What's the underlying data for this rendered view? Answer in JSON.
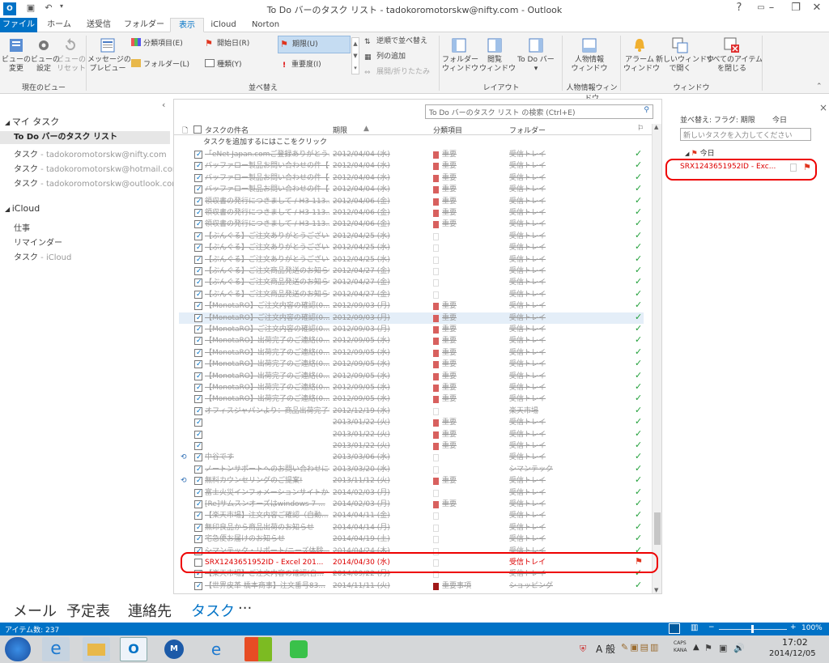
{
  "window": {
    "title": "To Do バーのタスク リスト - tadokoromotorskw@nifty.com - Outlook"
  },
  "tabs": [
    "ファイル",
    "ホーム",
    "送受信",
    "フォルダー",
    "表示",
    "iCloud",
    "Norton"
  ],
  "ribbon": {
    "view_change": "ビューの\n変更",
    "view_settings": "ビューの\n設定",
    "view_reset": "ビューの\nリセット",
    "message_preview": "メッセージの\nプレビュー",
    "category": "分類項目(E)",
    "start_date": "開始日(R)",
    "due_date": "期限(U)",
    "folder": "フォルダー(L)",
    "type": "種類(Y)",
    "importance": "重要度(I)",
    "reverse_sort": "逆順で並べ替え",
    "add_columns": "列の追加",
    "expand_collapse": "展開/折りたたみ",
    "folder_pane": "フォルダー\nウィンドウ",
    "reading_pane": "閲覧\nウィンドウ",
    "todo_bar": "To Do バー",
    "people_pane": "人物情報\nウィンドウ",
    "reminders": "アラーム\nウィンドウ",
    "open_new_window": "新しいウィンドウ\nで開く",
    "close_all": "すべてのアイテム\nを閉じる",
    "groups": {
      "current_view": "現在のビュー",
      "arrangement": "並べ替え",
      "layout": "レイアウト",
      "people": "人物情報ウィンドウ",
      "window": "ウィンドウ"
    }
  },
  "sidebar": {
    "my_tasks": "マイ タスク",
    "items": [
      {
        "label": "To Do バーのタスク リスト",
        "suffix": ""
      },
      {
        "label": "タスク",
        "suffix": " - tadokoromotorskw@nifty.com"
      },
      {
        "label": "タスク",
        "suffix": " - tadokoromotorskw@hotmail.com"
      },
      {
        "label": "タスク",
        "suffix": " - tadokoromotorskw@outlook.com"
      }
    ],
    "icloud": "iCloud",
    "icloud_items": [
      {
        "label": "仕事",
        "suffix": ""
      },
      {
        "label": "リマインダー",
        "suffix": ""
      },
      {
        "label": "タスク",
        "suffix": " - iCloud"
      }
    ]
  },
  "tasklist": {
    "search_placeholder": "To Do バーのタスク リスト の検索 (Ctrl+E)",
    "columns": {
      "subject": "タスクの件名",
      "due": "期限",
      "category": "分類項目",
      "folder": "フォルダー"
    },
    "add_task": "タスクを追加するにはここをクリック",
    "rows": [
      {
        "subject": "「eNet Japan.comご登録ありがとう...",
        "due": "2012/04/04 (水)",
        "cat": "red",
        "catname": "重要",
        "folder": "受信トレイ",
        "icon": ""
      },
      {
        "subject": "バッファロー製品お問い合わせの件【お...",
        "due": "2012/04/04 (水)",
        "cat": "red",
        "catname": "重要",
        "folder": "受信トレイ",
        "icon": ""
      },
      {
        "subject": "バッファロー製品お問い合わせの件【お...",
        "due": "2012/04/04 (水)",
        "cat": "red",
        "catname": "重要",
        "folder": "受信トレイ",
        "icon": ""
      },
      {
        "subject": "バッファロー製品お問い合わせの件【お...",
        "due": "2012/04/04 (水)",
        "cat": "red",
        "catname": "重要",
        "folder": "受信トレイ",
        "icon": ""
      },
      {
        "subject": "領収書の発行につきまして / H3-113...",
        "due": "2012/04/06 (金)",
        "cat": "red",
        "catname": "重要",
        "folder": "受信トレイ",
        "icon": ""
      },
      {
        "subject": "領収書の発行につきまして / H3-113...",
        "due": "2012/04/06 (金)",
        "cat": "red",
        "catname": "重要",
        "folder": "受信トレイ",
        "icon": ""
      },
      {
        "subject": "領収書の発行につきまして / H3-113...",
        "due": "2012/04/06 (金)",
        "cat": "red",
        "catname": "重要",
        "folder": "受信トレイ",
        "icon": ""
      },
      {
        "subject": "【ぶんぐる】ご注文ありがとうございます。",
        "due": "2012/04/25 (水)",
        "cat": "",
        "catname": "",
        "folder": "受信トレイ",
        "icon": ""
      },
      {
        "subject": "【ぶんぐる】ご注文ありがとうございます。",
        "due": "2012/04/25 (水)",
        "cat": "",
        "catname": "",
        "folder": "受信トレイ",
        "icon": ""
      },
      {
        "subject": "【ぶんぐる】ご注文ありがとうございます。",
        "due": "2012/04/25 (水)",
        "cat": "",
        "catname": "",
        "folder": "受信トレイ",
        "icon": ""
      },
      {
        "subject": "【ぶんぐる】ご注文商品発送のお知らせ",
        "due": "2012/04/27 (金)",
        "cat": "",
        "catname": "",
        "folder": "受信トレイ",
        "icon": ""
      },
      {
        "subject": "【ぶんぐる】ご注文商品発送のお知らせ",
        "due": "2012/04/27 (金)",
        "cat": "",
        "catname": "",
        "folder": "受信トレイ",
        "icon": ""
      },
      {
        "subject": "【ぶんぐる】ご注文商品発送のお知らせ",
        "due": "2012/04/27 (金)",
        "cat": "",
        "catname": "",
        "folder": "受信トレイ",
        "icon": ""
      },
      {
        "subject": "【MonotaRO】ご注文内容の確認(0...",
        "due": "2012/09/03 (月)",
        "cat": "red",
        "catname": "重要",
        "folder": "受信トレイ",
        "icon": ""
      },
      {
        "subject": "【MonotaRO】ご注文内容の確認(0...",
        "due": "2012/09/03 (月)",
        "cat": "red",
        "catname": "重要",
        "folder": "受信トレイ",
        "icon": "",
        "hl": true
      },
      {
        "subject": "【MonotaRO】ご注文内容の確認(0...",
        "due": "2012/09/03 (月)",
        "cat": "red",
        "catname": "重要",
        "folder": "受信トレイ",
        "icon": ""
      },
      {
        "subject": "【MonotaRO】出荷完了のご連絡(0...",
        "due": "2012/09/05 (水)",
        "cat": "red",
        "catname": "重要",
        "folder": "受信トレイ",
        "icon": ""
      },
      {
        "subject": "【MonotaRO】出荷完了のご連絡(0...",
        "due": "2012/09/05 (水)",
        "cat": "red",
        "catname": "重要",
        "folder": "受信トレイ",
        "icon": ""
      },
      {
        "subject": "【MonotaRO】出荷完了のご連絡(0...",
        "due": "2012/09/05 (水)",
        "cat": "red",
        "catname": "重要",
        "folder": "受信トレイ",
        "icon": ""
      },
      {
        "subject": "【MonotaRO】出荷完了のご連絡(0...",
        "due": "2012/09/05 (水)",
        "cat": "red",
        "catname": "重要",
        "folder": "受信トレイ",
        "icon": ""
      },
      {
        "subject": "【MonotaRO】出荷完了のご連絡(0...",
        "due": "2012/09/05 (水)",
        "cat": "red",
        "catname": "重要",
        "folder": "受信トレイ",
        "icon": ""
      },
      {
        "subject": "【MonotaRO】出荷完了のご連絡(0...",
        "due": "2012/09/05 (水)",
        "cat": "red",
        "catname": "重要",
        "folder": "受信トレイ",
        "icon": ""
      },
      {
        "subject": "オフィスジャパンより：商品出荷完了い...",
        "due": "2012/12/19 (水)",
        "cat": "",
        "catname": "",
        "folder": "楽天市場",
        "icon": ""
      },
      {
        "subject": "",
        "due": "2013/01/22 (火)",
        "cat": "red",
        "catname": "重要",
        "folder": "受信トレイ",
        "icon": ""
      },
      {
        "subject": "",
        "due": "2013/01/22 (火)",
        "cat": "red",
        "catname": "重要",
        "folder": "受信トレイ",
        "icon": ""
      },
      {
        "subject": "",
        "due": "2013/01/22 (火)",
        "cat": "red",
        "catname": "重要",
        "folder": "受信トレイ",
        "icon": ""
      },
      {
        "subject": "中谷です",
        "due": "2013/03/06 (水)",
        "cat": "",
        "catname": "",
        "folder": "受信トレイ",
        "icon": "⟲"
      },
      {
        "subject": "ノートンサポートへのお問い合わせにつ...",
        "due": "2013/03/20 (水)",
        "cat": "",
        "catname": "",
        "folder": "シマンテック",
        "icon": ""
      },
      {
        "subject": "無料カウンセリングのご提案!",
        "due": "2013/11/12 (火)",
        "cat": "red",
        "catname": "重要",
        "folder": "受信トレイ",
        "icon": "⟲"
      },
      {
        "subject": "富士火災インフォメーションサイトからの...",
        "due": "2014/02/03 (月)",
        "cat": "",
        "catname": "",
        "folder": "受信トレイ",
        "icon": ""
      },
      {
        "subject": "[Re]サムスンオーズはwindows 7 ...",
        "due": "2014/02/03 (月)",
        "cat": "red",
        "catname": "重要",
        "folder": "受信トレイ",
        "icon": ""
      },
      {
        "subject": "【楽天市場】注文内容ご確認（自動...",
        "due": "2014/04/11 (金)",
        "cat": "",
        "catname": "",
        "folder": "受信トレイ",
        "icon": ""
      },
      {
        "subject": "無印良品から商品出荷のお知らせ",
        "due": "2014/04/14 (月)",
        "cat": "",
        "catname": "",
        "folder": "受信トレイ",
        "icon": ""
      },
      {
        "subject": "宅急便お届けのお知らせ",
        "due": "2014/04/19 (土)",
        "cat": "",
        "catname": "",
        "folder": "受信トレイ",
        "icon": ""
      },
      {
        "subject": "シマンテック・リポート/ニーズ体験...",
        "due": "2014/04/24 (木)",
        "cat": "",
        "catname": "",
        "folder": "受信トレイ",
        "icon": ""
      },
      {
        "subject": "SRX1243651952ID - Excel 201...",
        "due": "2014/04/30 (水)",
        "cat": "",
        "catname": "",
        "folder": "受信トレイ",
        "icon": "",
        "red": true
      },
      {
        "subject": "【楽天市場】ご注文内容の確認(自...",
        "due": "2014/09/22 (月)",
        "cat": "",
        "catname": "",
        "folder": "受信トレイ",
        "icon": ""
      },
      {
        "subject": "【世界皮革 橋本商事】注文番号83...",
        "due": "2014/11/11 (火)",
        "cat": "dark",
        "catname": "重要事項",
        "folder": "ショッピング",
        "icon": ""
      }
    ]
  },
  "todobar": {
    "sort_label": "並べ替え: フラグ: 期限",
    "today_sort": "今日",
    "new_task_placeholder": "新しいタスクを入力してください",
    "group_today": "今日",
    "task_subject": "SRX1243651952ID - Exc..."
  },
  "navigation": [
    "メール",
    "予定表",
    "連絡先",
    "タスク",
    "···"
  ],
  "statusbar": {
    "item_count": "アイテム数: 237",
    "zoom": "100%"
  },
  "taskbar": {
    "ime": "A 般",
    "caps": "CAPS",
    "kana": "KANA",
    "time": "17:02",
    "date": "2014/12/05"
  },
  "colors": {
    "accent": "#0072c6",
    "category_red": "#d8605e",
    "category_dark": "#a01818",
    "flag_done": "#21a03a",
    "flag_red": "#e0341e",
    "highlight": "#e00000"
  }
}
